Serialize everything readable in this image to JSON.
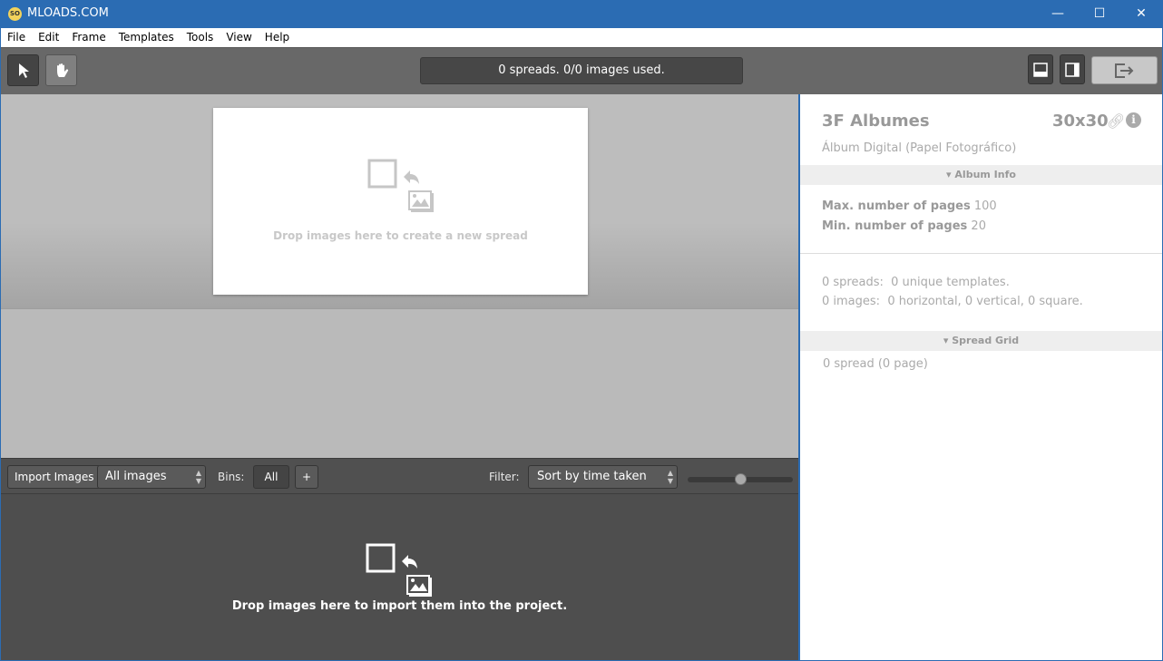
{
  "window": {
    "title": "MLOADS.COM",
    "logo_text": "SO",
    "minimize": "—",
    "maximize": "☐",
    "close": "✕"
  },
  "menu": [
    "File",
    "Edit",
    "Frame",
    "Templates",
    "Tools",
    "View",
    "Help"
  ],
  "toolbar": {
    "status": "0 spreads. 0/0 images used."
  },
  "canvas": {
    "drop_message": "Drop images here to create a new spread"
  },
  "bins_toolbar": {
    "import_label": "Import Images",
    "source_select": "All images",
    "bins_label": "Bins:",
    "bin_all": "All",
    "add_bin": "+",
    "filter_label": "Filter:",
    "sort_select": "Sort by time taken",
    "thumb_size_percent": 50
  },
  "dropzone": {
    "message": "Drop images here to import them into the project."
  },
  "panel": {
    "album_name": "3F Albumes",
    "size": "30x30",
    "subtitle": "Álbum Digital (Papel Fotográfico)",
    "album_info_header": "Album Info",
    "max_pages_label": "Max. number of pages",
    "max_pages": "100",
    "min_pages_label": "Min. number of pages",
    "min_pages": "20",
    "spreads_summary": "0 spreads:  0 unique templates.",
    "images_summary": "0 images:  0 horizontal, 0 vertical, 0 square.",
    "spread_grid_header": "Spread Grid",
    "spread_grid_summary": "0 spread (0 page)"
  },
  "colors": {
    "titlebar": "#2b6cb3",
    "toolbar": "#686868",
    "dropzone": "#4e4e4e"
  }
}
